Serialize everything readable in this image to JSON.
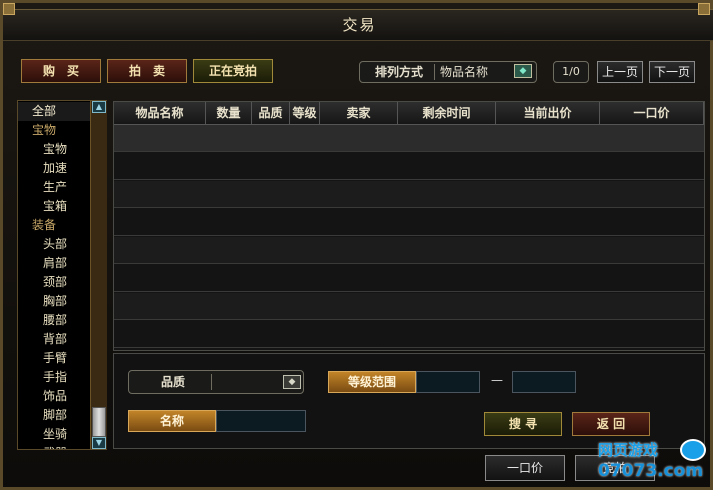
{
  "window": {
    "title": "交易"
  },
  "tabs": {
    "buy": "购　买",
    "auction": "拍　卖",
    "bidding": "正在竞拍"
  },
  "sort": {
    "label": "排列方式",
    "value": "物品名称"
  },
  "pagination": {
    "page": "1/0",
    "prev": "上一页",
    "next": "下一页"
  },
  "sidebar": {
    "items": [
      {
        "label": "全部",
        "level": 0,
        "selected": true
      },
      {
        "label": "宝物",
        "level": 0
      },
      {
        "label": "宝物",
        "level": 1
      },
      {
        "label": "加速",
        "level": 1
      },
      {
        "label": "生产",
        "level": 1
      },
      {
        "label": "宝箱",
        "level": 1
      },
      {
        "label": "装备",
        "level": 0
      },
      {
        "label": "头部",
        "level": 1
      },
      {
        "label": "肩部",
        "level": 1
      },
      {
        "label": "颈部",
        "level": 1
      },
      {
        "label": "胸部",
        "level": 1
      },
      {
        "label": "腰部",
        "level": 1
      },
      {
        "label": "背部",
        "level": 1
      },
      {
        "label": "手臂",
        "level": 1
      },
      {
        "label": "手指",
        "level": 1
      },
      {
        "label": "饰品",
        "level": 1
      },
      {
        "label": "脚部",
        "level": 1
      },
      {
        "label": "坐骑",
        "level": 1
      },
      {
        "label": "武器",
        "level": 1
      }
    ]
  },
  "table": {
    "columns": [
      "物品名称",
      "数量",
      "品质",
      "等级",
      "卖家",
      "剩余时间",
      "当前出价",
      "一口价"
    ],
    "rows": 8
  },
  "filters": {
    "quality_label": "品质",
    "quality_value": "",
    "level_label": "等级范围",
    "level_dash": "—",
    "name_label": "名称",
    "search": "搜 寻",
    "back": "返 回"
  },
  "footer": {
    "buyout": "一口价",
    "bid": "竞拍"
  },
  "watermark": {
    "text": "网页游戏",
    "domain": "07073.com"
  },
  "colors": {
    "accent_orange": "#c28428",
    "frame_gold": "#8b6a2a",
    "teal_icon": "#5fc8b0"
  }
}
